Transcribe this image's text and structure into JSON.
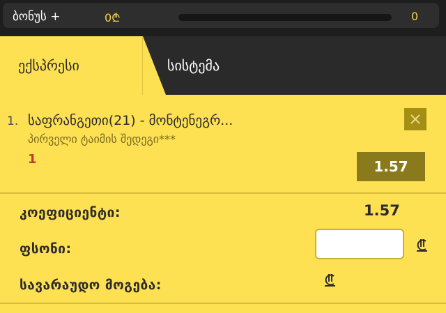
{
  "bonus": {
    "label": "ბონუს +",
    "amount": "0₾",
    "count": "0",
    "progress_fraction": 0
  },
  "tabs": {
    "express_label": "ექსპრესი",
    "system_label": "სისტემა"
  },
  "bet": {
    "index": "1.",
    "match": "საფრანგეთი(21) - მონტენეგრ...",
    "market": "პირველი ტაიმის შედეგი***",
    "pick": "1",
    "odds": "1.57",
    "close_icon": "close-icon"
  },
  "summary": {
    "coefficient_label": "კოეფიციენტი:",
    "coefficient_value": "1.57",
    "stake_label": "ფსონი:",
    "stake_value": "",
    "stake_placeholder": "",
    "possible_win_label": "სავარაუდო მოგება:",
    "currency_icon": "lari-icon"
  },
  "colors": {
    "accent": "#fde152",
    "dark": "#1e1e1e",
    "odds_box": "#8b7a1c",
    "pick_red": "#c0392b"
  }
}
